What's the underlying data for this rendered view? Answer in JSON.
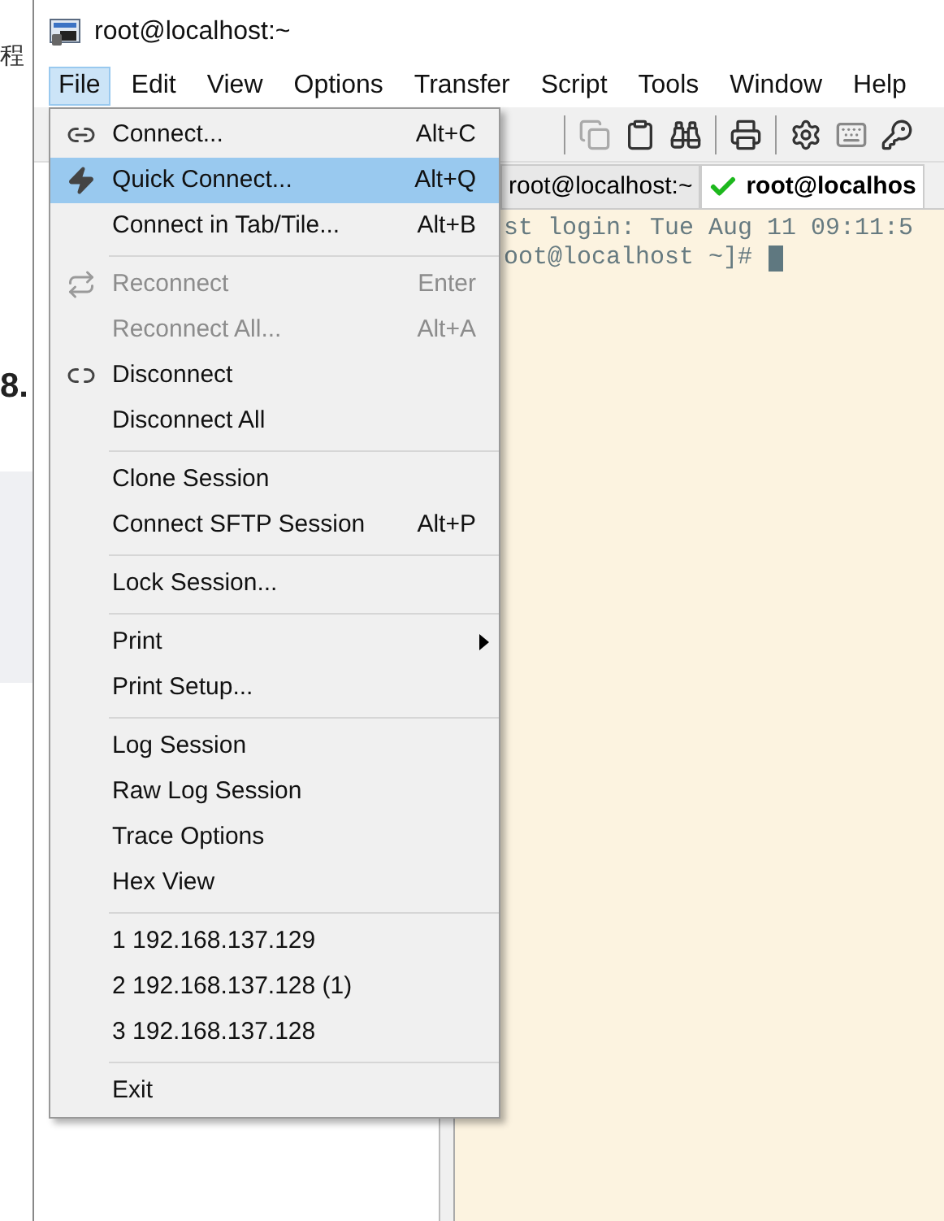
{
  "behind_page": {
    "side_label": "程",
    "heading": "8."
  },
  "window": {
    "title": "root@localhost:~"
  },
  "menubar": [
    {
      "label": "File",
      "selected": true
    },
    {
      "label": "Edit",
      "selected": false
    },
    {
      "label": "View",
      "selected": false
    },
    {
      "label": "Options",
      "selected": false
    },
    {
      "label": "Transfer",
      "selected": false
    },
    {
      "label": "Script",
      "selected": false
    },
    {
      "label": "Tools",
      "selected": false
    },
    {
      "label": "Window",
      "selected": false
    },
    {
      "label": "Help",
      "selected": false
    }
  ],
  "tabs": [
    {
      "label": "root@localhost:~",
      "selected": false,
      "connected": false
    },
    {
      "label": "root@localhos",
      "selected": true,
      "connected": true
    }
  ],
  "terminal": {
    "lines": [
      "st login: Tue Aug 11 09:11:5",
      "oot@localhost ~]#"
    ],
    "cursor": true
  },
  "file_menu": [
    {
      "kind": "item",
      "label": "Connect...",
      "shortcut": "Alt+C",
      "disabled": false,
      "selected": false,
      "submenu": false
    },
    {
      "kind": "item",
      "label": "Quick Connect...",
      "shortcut": "Alt+Q",
      "disabled": false,
      "selected": true,
      "submenu": false
    },
    {
      "kind": "item",
      "label": "Connect in Tab/Tile...",
      "shortcut": "Alt+B",
      "disabled": false,
      "selected": false,
      "submenu": false
    },
    {
      "kind": "separator"
    },
    {
      "kind": "item",
      "label": "Reconnect",
      "shortcut": "Enter",
      "disabled": true,
      "selected": false,
      "submenu": false
    },
    {
      "kind": "item",
      "label": "Reconnect All...",
      "shortcut": "Alt+A",
      "disabled": true,
      "selected": false,
      "submenu": false
    },
    {
      "kind": "item",
      "label": "Disconnect",
      "disabled": false,
      "selected": false,
      "submenu": false
    },
    {
      "kind": "item",
      "label": "Disconnect All",
      "disabled": false,
      "selected": false,
      "submenu": false
    },
    {
      "kind": "separator"
    },
    {
      "kind": "item",
      "label": "Clone Session",
      "disabled": false,
      "selected": false,
      "submenu": false
    },
    {
      "kind": "item",
      "label": "Connect SFTP Session",
      "shortcut": "Alt+P",
      "disabled": false,
      "selected": false,
      "submenu": false
    },
    {
      "kind": "separator"
    },
    {
      "kind": "item",
      "label": "Lock Session...",
      "disabled": false,
      "selected": false,
      "submenu": false
    },
    {
      "kind": "separator"
    },
    {
      "kind": "item",
      "label": "Print",
      "disabled": false,
      "selected": false,
      "submenu": true
    },
    {
      "kind": "item",
      "label": "Print Setup...",
      "disabled": false,
      "selected": false,
      "submenu": false
    },
    {
      "kind": "separator"
    },
    {
      "kind": "item",
      "label": "Log Session",
      "disabled": false,
      "selected": false,
      "submenu": false
    },
    {
      "kind": "item",
      "label": "Raw Log Session",
      "disabled": false,
      "selected": false,
      "submenu": false
    },
    {
      "kind": "item",
      "label": "Trace Options",
      "disabled": false,
      "selected": false,
      "submenu": false
    },
    {
      "kind": "item",
      "label": "Hex View",
      "disabled": false,
      "selected": false,
      "submenu": false
    },
    {
      "kind": "separator"
    },
    {
      "kind": "item",
      "label": "1 192.168.137.129",
      "disabled": false,
      "selected": false,
      "submenu": false
    },
    {
      "kind": "item",
      "label": "2 192.168.137.128 (1)",
      "disabled": false,
      "selected": false,
      "submenu": false
    },
    {
      "kind": "item",
      "label": "3 192.168.137.128",
      "disabled": false,
      "selected": false,
      "submenu": false
    },
    {
      "kind": "separator"
    },
    {
      "kind": "item",
      "label": "Exit",
      "disabled": false,
      "selected": false,
      "submenu": false
    }
  ]
}
